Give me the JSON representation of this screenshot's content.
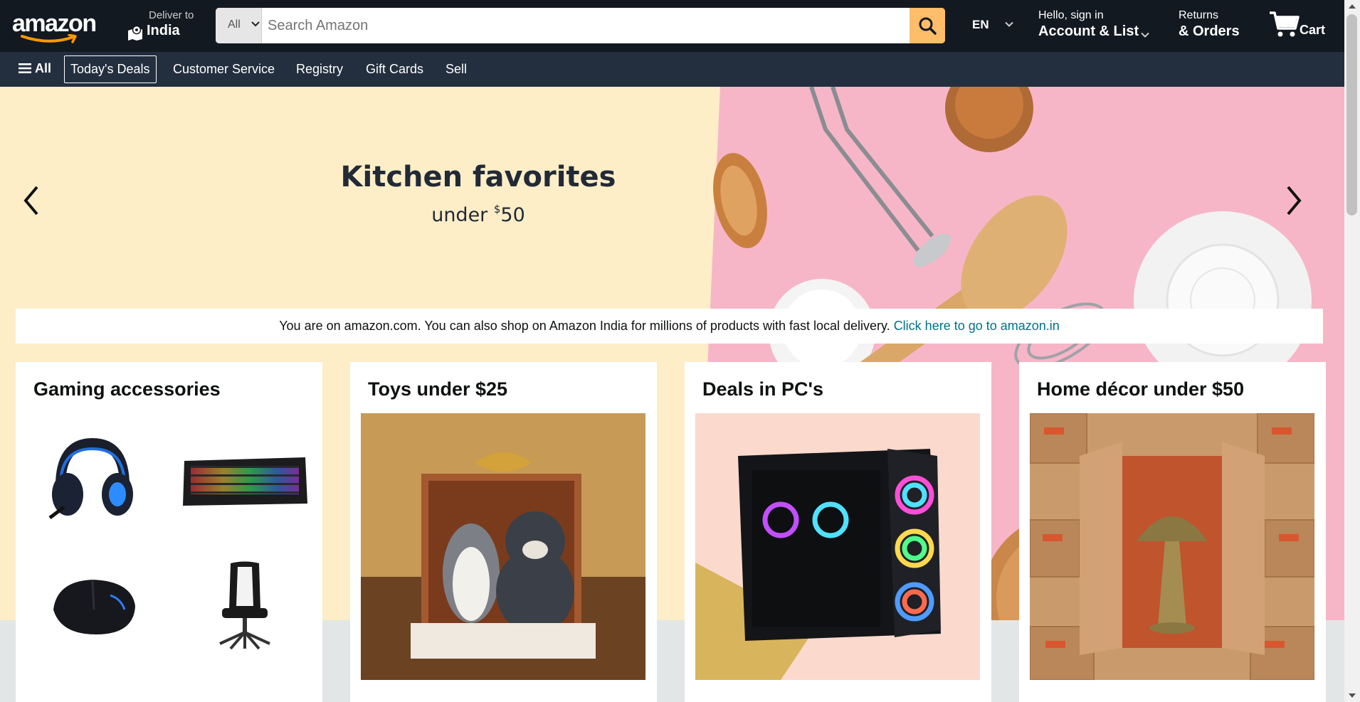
{
  "header": {
    "logo": "amazon",
    "deliver_label": "Deliver to",
    "deliver_location": "India",
    "search": {
      "category": "All",
      "placeholder": "Search Amazon"
    },
    "language": "EN",
    "account_line1": "Hello, sign in",
    "account_line2": "Account & List",
    "orders_line1": "Returns",
    "orders_line2": "& Orders",
    "cart_label": "Cart"
  },
  "subnav": {
    "all_label": "All",
    "links": [
      "Today's Deals",
      "Customer Service",
      "Registry",
      "Gift Cards",
      "Sell"
    ]
  },
  "hero": {
    "title": "Kitchen favorites",
    "subtitle_prefix": "under ",
    "subtitle_currency": "$",
    "subtitle_amount": "50"
  },
  "notice": {
    "text": "You are on amazon.com. You can also shop on Amazon India for millions of products with fast local delivery. ",
    "link": "Click here to go to amazon.in"
  },
  "cards": [
    {
      "title": "Gaming accessories",
      "items": [
        "headset-image",
        "keyboard-image",
        "mouse-image",
        "gaming-chair-image"
      ]
    },
    {
      "title": "Toys under $25"
    },
    {
      "title": "Deals in PC's"
    },
    {
      "title": "Home décor under $50"
    }
  ],
  "colors": {
    "nav_dark": "#131921",
    "nav_sub": "#232f3e",
    "search_button": "#febd69",
    "hero_cream": "#fdeec8",
    "hero_pink": "#f7b6c8",
    "link": "#007185"
  }
}
